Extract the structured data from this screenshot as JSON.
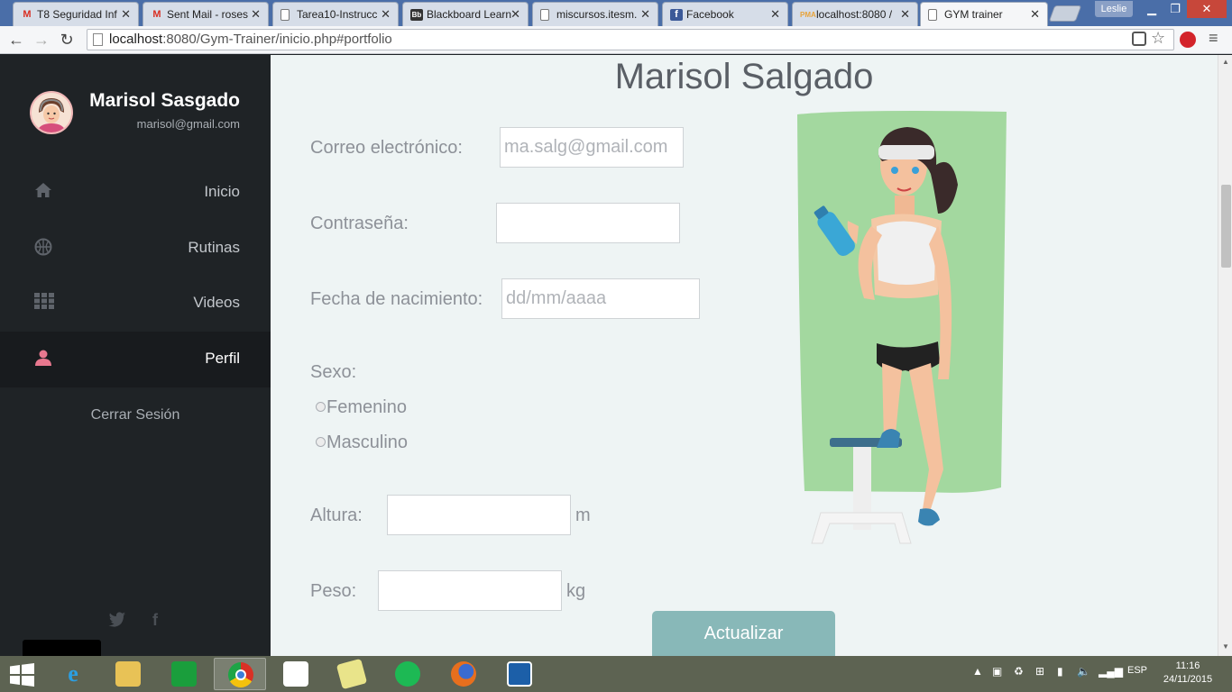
{
  "browser": {
    "tabs": [
      {
        "title": "T8 Seguridad Inf",
        "favicon": "gmail-icon",
        "active": false
      },
      {
        "title": "Sent Mail - roses",
        "favicon": "gmail-icon",
        "active": false
      },
      {
        "title": "Tarea10-Instrucc",
        "favicon": "page-icon",
        "active": false
      },
      {
        "title": "Blackboard Learn",
        "favicon": "blackboard-icon",
        "active": false
      },
      {
        "title": "miscursos.itesm.",
        "favicon": "page-icon",
        "active": false
      },
      {
        "title": "Facebook",
        "favicon": "facebook-icon",
        "active": false
      },
      {
        "title": "localhost:8080 /",
        "favicon": "phpmyadmin-icon",
        "active": false
      },
      {
        "title": "GYM trainer",
        "favicon": "page-icon",
        "active": true
      }
    ],
    "user_badge": "Leslie",
    "url_host": "localhost",
    "url_rest": ":8080/Gym-Trainer/inicio.php#portfolio"
  },
  "sidebar": {
    "user_name": "Marisol Sasgado",
    "user_email": "marisol@gmail.com",
    "nav": [
      {
        "label": "Inicio",
        "icon": "home-icon",
        "active": false
      },
      {
        "label": "Rutinas",
        "icon": "basketball-icon",
        "active": false
      },
      {
        "label": "Videos",
        "icon": "grid-icon",
        "active": false
      },
      {
        "label": "Perfil",
        "icon": "user-icon",
        "active": true
      }
    ],
    "logout_label": "Cerrar Sesión",
    "social": [
      "twitter-icon",
      "facebook-icon"
    ],
    "active_color": "#e8788f"
  },
  "profile": {
    "title": "Marisol Salgado",
    "email_label": "Correo electrónico:",
    "email_placeholder": "ma.salg@gmail.com",
    "password_label": "Contraseña:",
    "password_value": "",
    "birthdate_label": "Fecha de nacimiento:",
    "birthdate_placeholder": "dd/mm/aaaa",
    "sex_label": "Sexo:",
    "sex_options": [
      "Femenino",
      "Masculino"
    ],
    "height_label": "Altura:",
    "height_unit": "m",
    "weight_label": "Peso:",
    "weight_unit": "kg",
    "update_button": "Actualizar",
    "accent_color": "#88b8b8"
  },
  "taskbar": {
    "apps": [
      "windows-start-icon",
      "internet-explorer-icon",
      "file-explorer-icon",
      "store-icon",
      "chrome-icon",
      "apps-grid-icon",
      "sticky-notes-icon",
      "spotify-icon",
      "firefox-icon",
      "code-icon"
    ],
    "language": "ESP",
    "time": "11:16",
    "date": "24/11/2015"
  }
}
